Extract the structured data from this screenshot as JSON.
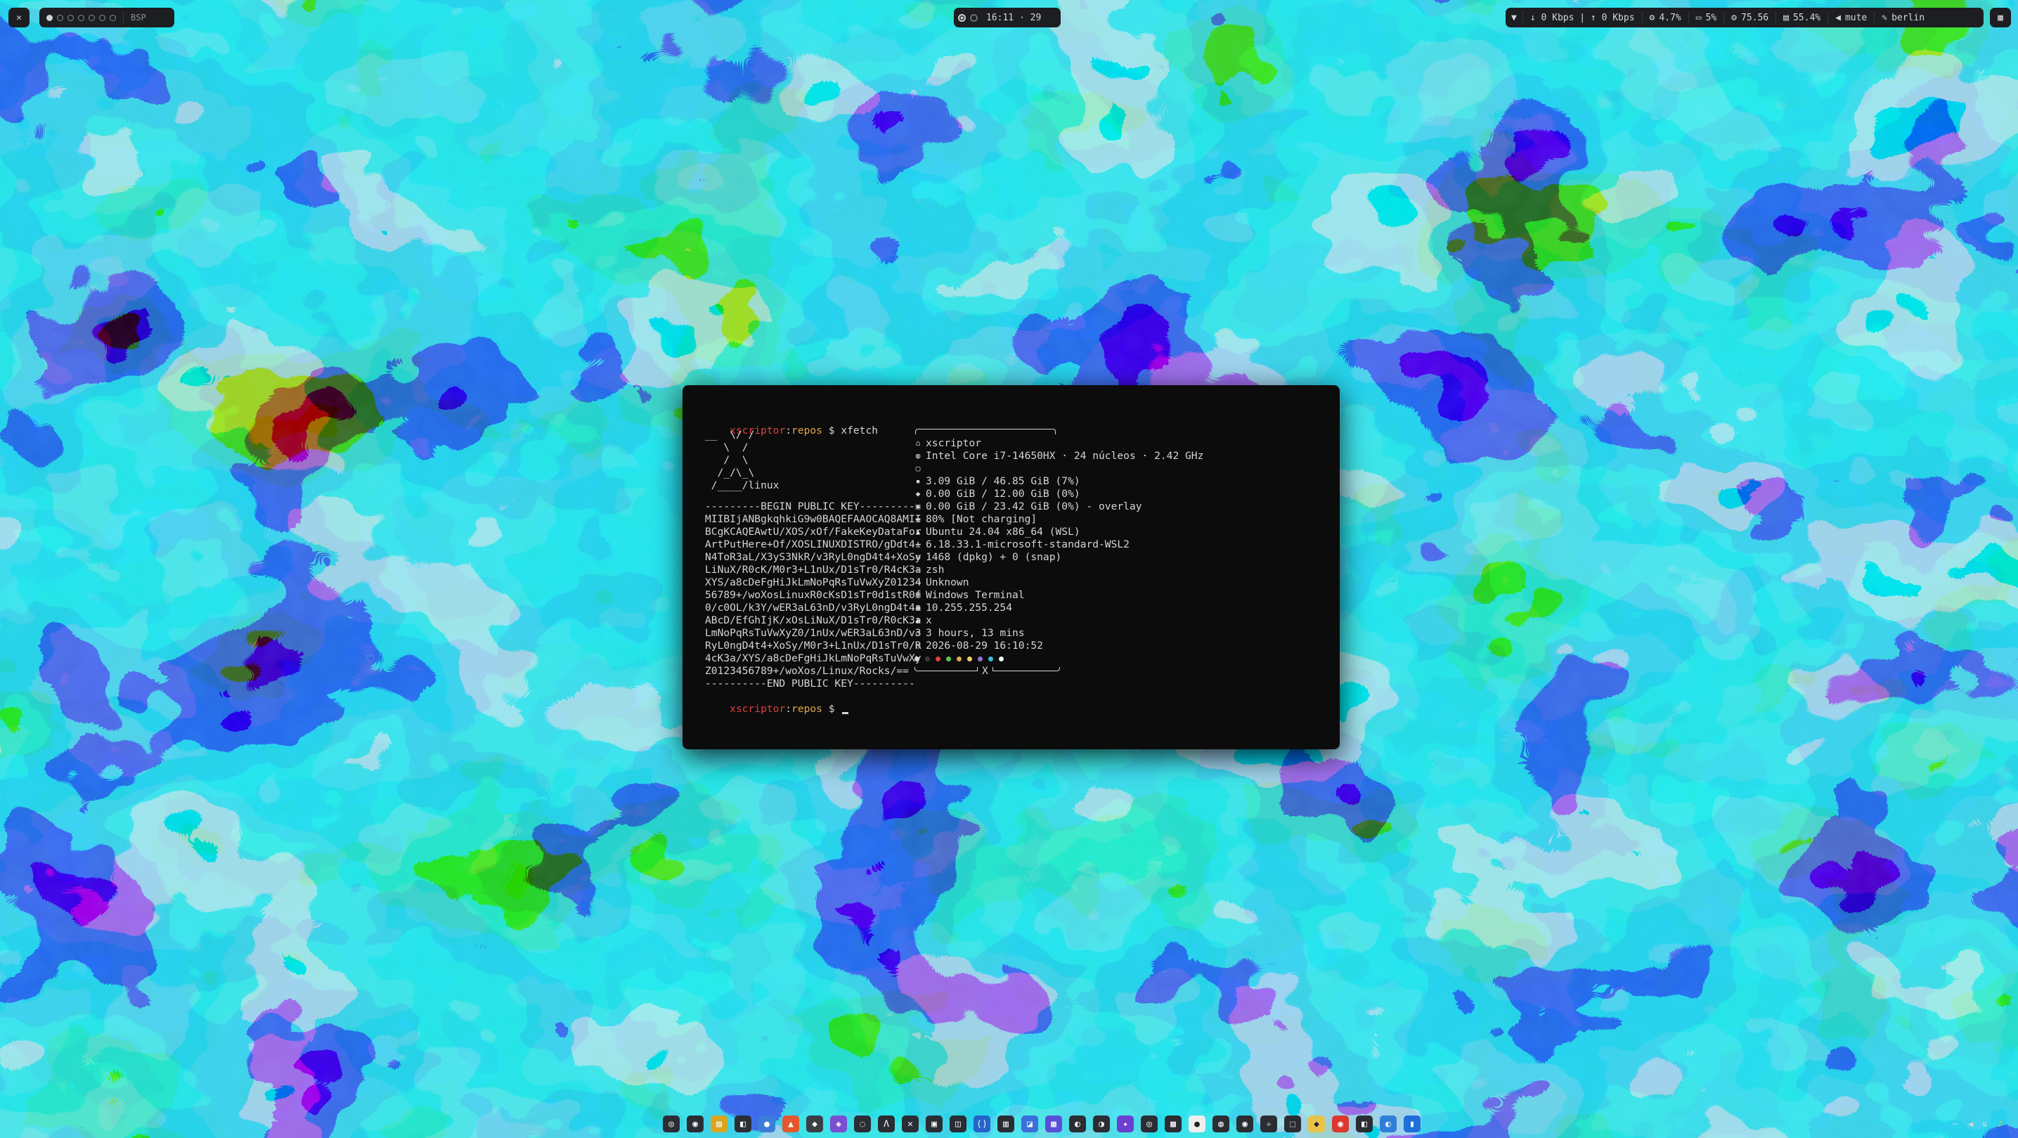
{
  "topbar": {
    "close_glyph": "✕",
    "layout": "BSP",
    "time": "16:11 · 29",
    "network": "↓ 0 Kbps | ↑ 0 Kbps",
    "cpu": "4.7%",
    "gpu": "5%",
    "temp": "75.56",
    "disk": "55.4%",
    "volume": "mute",
    "city": "berlin",
    "workspaces_total": 7,
    "workspace_active": 1
  },
  "terminal": {
    "prompt_user": "xscriptor",
    "prompt_colon": ":",
    "prompt_path": "repos",
    "prompt_symbol": " $ ",
    "command": "xfetch",
    "ascii_art": "__  \\/ /\n   \\  /\n   /  \\\n  /_/\\_\\\n /____/linux",
    "key_lines": [
      "---------BEGIN PUBLIC KEY---------",
      "MIIBIjANBgkqhkiG9w0BAQEFAAOCAQ8AMII",
      "BCgKCAQEAwtU/XOS/xOf/FakeKeyDataFor",
      "ArtPutHere+Of/XOSLINUXDISTRO/gDdt4+",
      "N4ToR3aL/X3yS3NkR/v3RyL0ngD4t4+XoSy",
      "LiNuX/R0cK/M0r3+L1nUx/D1sTr0/R4cK3a",
      "XYS/a8cDeFgHiJkLmNoPqRsTuVwXyZ01234",
      "56789+/woXosLinuxR0cKsD1sTr0d1stR0f",
      "0/c0OL/k3Y/wER3aL63nD/v3RyL0ngD4t4a",
      "ABcD/EfGhIjK/xOsLiNuX/D1sTr0/R0cK3a",
      "LmNoPqRsTuVwXyZ0/1nUx/wER3aL63nD/v3",
      "RyL0ngD4t4+XoSy/M0r3+L1nUx/D1sTr0/R",
      "4cK3a/XYS/a8cDeFgHiJkLmNoPqRsTuVwXy",
      "Z0123456789+/woXos/Linux/Rocks/==",
      "----------END PUBLIC KEY----------"
    ],
    "info": [
      {
        "icon": "user",
        "text": "xscriptor"
      },
      {
        "icon": "cpu",
        "text": "Intel Core i7-14650HX · 24 núcleos · 2.42 GHz"
      },
      {
        "icon": "gpu",
        "text": ""
      },
      {
        "icon": "memory",
        "text": "3.09 GiB / 46.85 GiB (7%)"
      },
      {
        "icon": "swap",
        "text": "0.00 GiB / 12.00 GiB (0%)"
      },
      {
        "icon": "disk",
        "text": "0.00 GiB / 23.42 GiB (0%) - overlay"
      },
      {
        "icon": "battery",
        "text": "80% [Not charging]"
      },
      {
        "icon": "os",
        "text": "Ubuntu 24.04 x86_64 (WSL)"
      },
      {
        "icon": "kernel",
        "text": "6.18.33.1-microsoft-standard-WSL2"
      },
      {
        "icon": "packages",
        "text": "1468 (dpkg) + 0 (snap)"
      },
      {
        "icon": "shell",
        "text": "zsh"
      },
      {
        "icon": "de",
        "text": "Unknown"
      },
      {
        "icon": "terminal",
        "text": "Windows Terminal"
      },
      {
        "icon": "ip",
        "text": "10.255.255.254"
      },
      {
        "icon": "host",
        "text": "x"
      },
      {
        "icon": "uptime",
        "text": "3 hours, 13 mins"
      },
      {
        "icon": "date",
        "text": "2026-08-29 16:10:52"
      }
    ],
    "box_bottom_label": "X",
    "palette": [
      "#d5d5d5",
      "#3a3a3a",
      "#e0413c",
      "#57c55a",
      "#e0a84a",
      "#f0d060",
      "#8f76d6",
      "#3dbfd4",
      "#f2f2f2"
    ]
  },
  "dock": [
    {
      "name": "dock-app-1",
      "glyph": "◎",
      "color": "#2a2d33"
    },
    {
      "name": "dock-app-2",
      "glyph": "◉",
      "color": "#2a2d33"
    },
    {
      "name": "dock-app-3",
      "glyph": "▤",
      "color": "#d9a521"
    },
    {
      "name": "dock-app-4",
      "glyph": "◧",
      "color": "#2b2e34"
    },
    {
      "name": "dock-app-5",
      "glyph": "●",
      "color": "#3c7ed6"
    },
    {
      "name": "dock-app-6",
      "glyph": "▲",
      "color": "#e4572e"
    },
    {
      "name": "dock-app-7",
      "glyph": "◆",
      "color": "#3b3f46"
    },
    {
      "name": "dock-app-8",
      "glyph": "◈",
      "color": "#7a4fd1"
    },
    {
      "name": "dock-app-9",
      "glyph": "◌",
      "color": "#2a2d33"
    },
    {
      "name": "dock-app-10",
      "glyph": "Λ",
      "color": "#2a2d33"
    },
    {
      "name": "dock-app-11",
      "glyph": "✕",
      "color": "#2a2d33"
    },
    {
      "name": "dock-app-12",
      "glyph": "▣",
      "color": "#2a2d33"
    },
    {
      "name": "dock-app-13",
      "glyph": "◫",
      "color": "#2a2d33"
    },
    {
      "name": "dock-app-14",
      "glyph": "⟨⟩",
      "color": "#2463c7"
    },
    {
      "name": "dock-app-15",
      "glyph": "▥",
      "color": "#2a2d33"
    },
    {
      "name": "dock-app-16",
      "glyph": "◪",
      "color": "#3b6fd9"
    },
    {
      "name": "dock-app-17",
      "glyph": "▦",
      "color": "#5a4fd9"
    },
    {
      "name": "dock-app-18",
      "glyph": "◐",
      "color": "#2a2d33"
    },
    {
      "name": "dock-app-19",
      "glyph": "◑",
      "color": "#2a2d33"
    },
    {
      "name": "dock-app-20",
      "glyph": "✦",
      "color": "#6b3fd1"
    },
    {
      "name": "dock-app-21",
      "glyph": "◎",
      "color": "#2a2d33"
    },
    {
      "name": "dock-app-22",
      "glyph": "▩",
      "color": "#2a2d33"
    },
    {
      "name": "dock-app-23",
      "glyph": "●",
      "color": "#eeeeee"
    },
    {
      "name": "dock-app-24",
      "glyph": "◍",
      "color": "#2a2d33"
    },
    {
      "name": "dock-app-25",
      "glyph": "◉",
      "color": "#2a2d33"
    },
    {
      "name": "dock-app-26",
      "glyph": "✧",
      "color": "#2a2d33"
    },
    {
      "name": "dock-app-27",
      "glyph": "⬚",
      "color": "#2a2d33"
    },
    {
      "name": "dock-app-28",
      "glyph": "◆",
      "color": "#e8c34a"
    },
    {
      "name": "dock-app-29",
      "glyph": "◉",
      "color": "#d9392e"
    },
    {
      "name": "dock-app-30",
      "glyph": "◧",
      "color": "#2a2d33"
    },
    {
      "name": "dock-app-31",
      "glyph": "◐",
      "color": "#2f7fd9"
    },
    {
      "name": "dock-app-32",
      "glyph": "▮",
      "color": "#1e6fd9"
    }
  ]
}
